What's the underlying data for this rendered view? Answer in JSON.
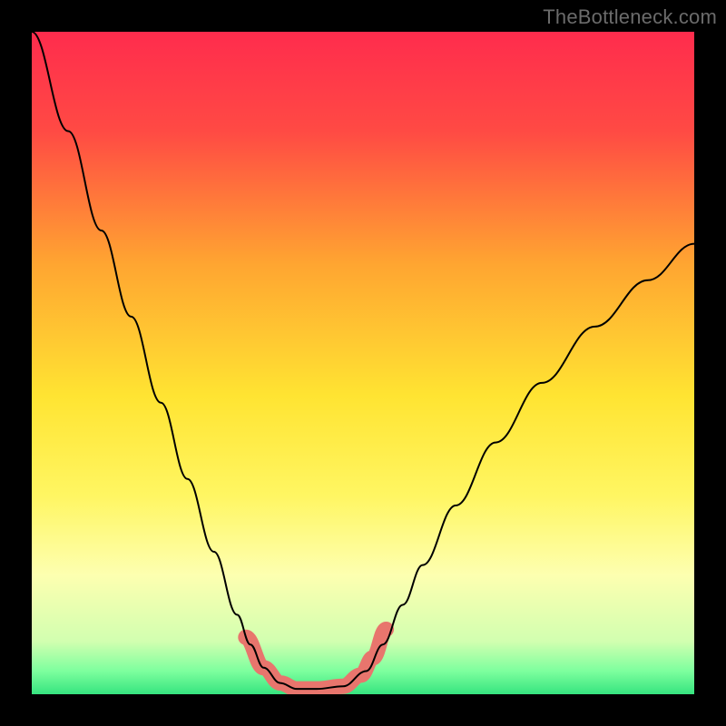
{
  "watermark": "TheBottleneck.com",
  "chart_data": {
    "type": "line",
    "title": "",
    "xlabel": "",
    "ylabel": "",
    "xlim": [
      0,
      1
    ],
    "ylim": [
      0,
      1
    ],
    "background_gradient": {
      "stops": [
        {
          "offset": 0.0,
          "color": "#ff2c4d"
        },
        {
          "offset": 0.15,
          "color": "#ff4a44"
        },
        {
          "offset": 0.35,
          "color": "#ffa531"
        },
        {
          "offset": 0.55,
          "color": "#ffe432"
        },
        {
          "offset": 0.7,
          "color": "#fff662"
        },
        {
          "offset": 0.82,
          "color": "#fdffb0"
        },
        {
          "offset": 0.92,
          "color": "#d2ffb0"
        },
        {
          "offset": 0.965,
          "color": "#7dff9e"
        },
        {
          "offset": 1.0,
          "color": "#36e47f"
        }
      ]
    },
    "series": [
      {
        "name": "bottleneck-curve",
        "stroke": "#000000",
        "stroke_width": 2,
        "x": [
          0.0,
          0.055,
          0.105,
          0.15,
          0.195,
          0.235,
          0.275,
          0.31,
          0.33,
          0.35,
          0.375,
          0.4,
          0.43,
          0.47,
          0.505,
          0.53,
          0.56,
          0.59,
          0.64,
          0.7,
          0.77,
          0.85,
          0.93,
          1.0
        ],
        "values": [
          1.0,
          0.85,
          0.7,
          0.57,
          0.44,
          0.325,
          0.215,
          0.12,
          0.075,
          0.04,
          0.017,
          0.008,
          0.008,
          0.012,
          0.035,
          0.075,
          0.135,
          0.195,
          0.285,
          0.38,
          0.47,
          0.555,
          0.625,
          0.68
        ]
      },
      {
        "name": "highlight-band",
        "stroke": "#e8756d",
        "stroke_width": 17,
        "linecap": "round",
        "x": [
          0.323,
          0.35,
          0.375,
          0.4,
          0.43,
          0.47,
          0.497,
          0.515,
          0.535
        ],
        "values": [
          0.086,
          0.04,
          0.017,
          0.008,
          0.008,
          0.012,
          0.029,
          0.055,
          0.098
        ]
      }
    ]
  }
}
